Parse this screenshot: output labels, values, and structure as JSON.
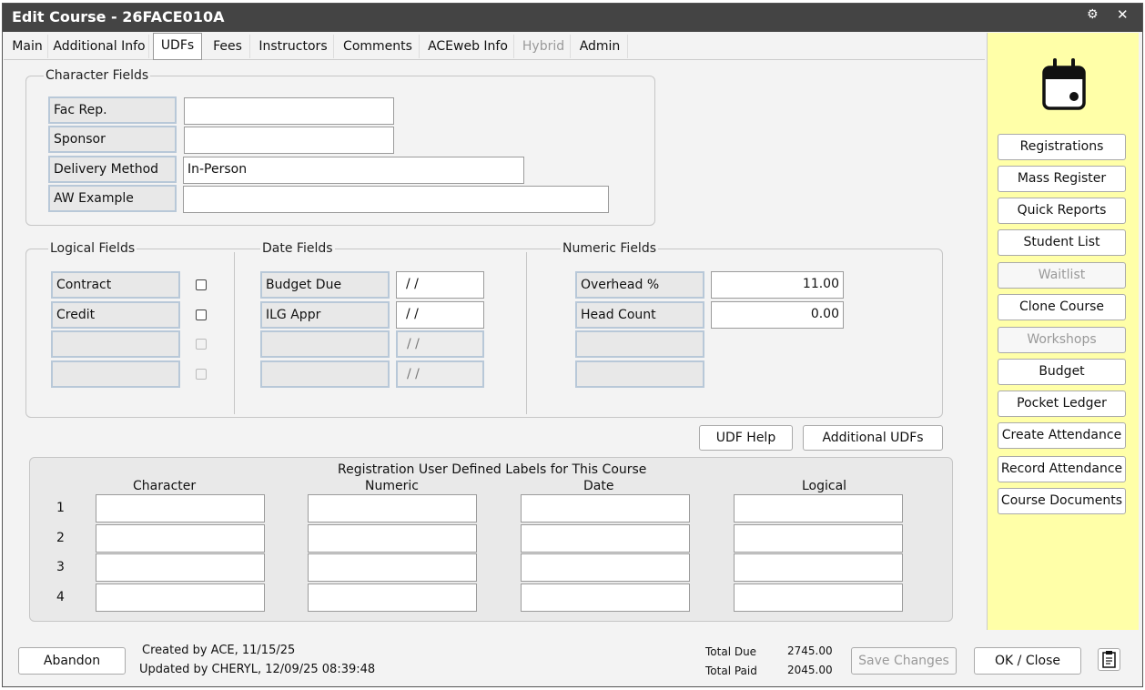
{
  "window": {
    "title": "Edit Course - 26FACE010A"
  },
  "tabs": [
    {
      "label": "Main"
    },
    {
      "label": "Additional Info"
    },
    {
      "label": "UDFs"
    },
    {
      "label": "Fees"
    },
    {
      "label": "Instructors"
    },
    {
      "label": "Comments"
    },
    {
      "label": "ACEweb Info"
    },
    {
      "label": "Hybrid"
    },
    {
      "label": "Admin"
    }
  ],
  "character_fields": {
    "legend": "Character Fields",
    "rows": [
      {
        "label": "Fac Rep.",
        "value": ""
      },
      {
        "label": "Sponsor",
        "value": ""
      },
      {
        "label": "Delivery Method",
        "value": "In-Person"
      },
      {
        "label": "AW Example",
        "value": ""
      }
    ]
  },
  "logical_fields": {
    "legend": "Logical Fields",
    "rows": [
      {
        "label": "Contract",
        "checked": false
      },
      {
        "label": "Credit",
        "checked": false
      },
      {
        "label": "",
        "checked": false
      },
      {
        "label": "",
        "checked": false
      }
    ]
  },
  "date_fields": {
    "legend": "Date Fields",
    "rows": [
      {
        "label": "Budget Due",
        "value": " /  /"
      },
      {
        "label": "ILG Appr",
        "value": " /  /"
      },
      {
        "label": "",
        "value": " /  /"
      },
      {
        "label": "",
        "value": " /  /"
      }
    ]
  },
  "numeric_fields": {
    "legend": "Numeric Fields",
    "rows": [
      {
        "label": "Overhead %",
        "value": "11.00"
      },
      {
        "label": "Head Count",
        "value": "0.00"
      },
      {
        "label": "",
        "value": ""
      },
      {
        "label": "",
        "value": ""
      }
    ]
  },
  "buttons": {
    "udf_help": "UDF Help",
    "additional_udfs": "Additional UDFs"
  },
  "reg_labels": {
    "title": "Registration User Defined Labels for This Course",
    "columns": [
      "Character",
      "Numeric",
      "Date",
      "Logical"
    ],
    "row_numbers": [
      "1",
      "2",
      "3",
      "4"
    ]
  },
  "side_panel": {
    "icon": "calendar-icon",
    "buttons": [
      {
        "label": "Registrations",
        "enabled": true
      },
      {
        "label": "Mass Register",
        "enabled": true
      },
      {
        "label": "Quick Reports",
        "enabled": true
      },
      {
        "label": "Student List",
        "enabled": true
      },
      {
        "label": "Waitlist",
        "enabled": false
      },
      {
        "label": "Clone Course",
        "enabled": true
      },
      {
        "label": "Workshops",
        "enabled": false
      },
      {
        "label": "Budget",
        "enabled": true
      },
      {
        "label": "Pocket Ledger",
        "enabled": true
      },
      {
        "label": "Create Attendance",
        "enabled": true
      },
      {
        "label": "Record Attendance",
        "enabled": true
      },
      {
        "label": "Course Documents",
        "enabled": true
      }
    ],
    "background": "#ffffa8"
  },
  "footer": {
    "abandon": "Abandon",
    "created_by": "Created by  ACE, 11/15/25",
    "updated_by": "Updated by  CHERYL, 12/09/25 08:39:48",
    "total_due_label": "Total Due",
    "total_due_value": "2745.00",
    "total_paid_label": "Total Paid",
    "total_paid_value": "2045.00",
    "save_changes": "Save Changes",
    "ok_close": "OK / Close",
    "report_icon": "clipboard-icon"
  }
}
